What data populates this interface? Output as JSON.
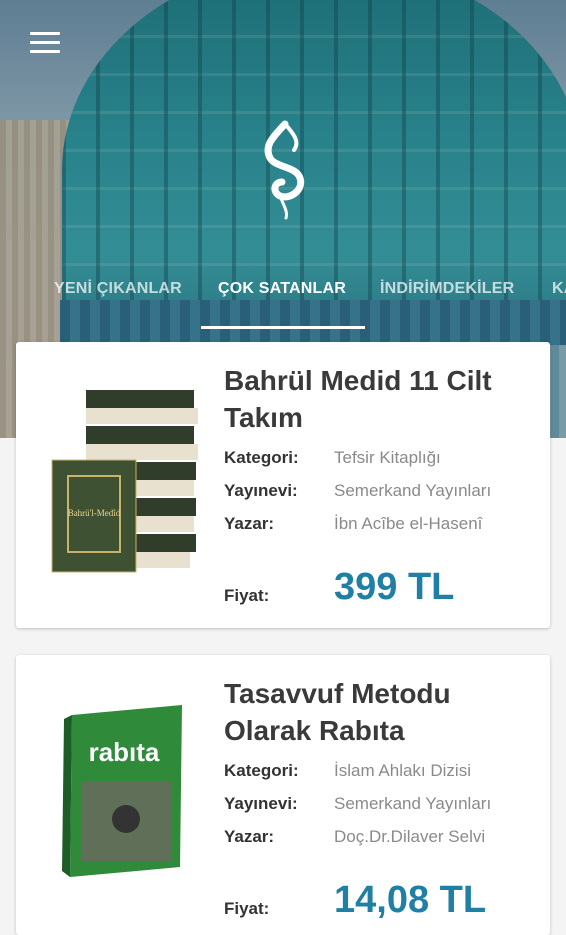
{
  "colors": {
    "accent": "#1f7fa4",
    "title": "#3a3a3a",
    "muted": "#8a8a8a"
  },
  "header": {
    "menu_icon": "hamburger-menu-icon",
    "logo_icon": "calligraphy-logo-icon"
  },
  "tabs": [
    {
      "label": "YENİ ÇIKANLAR",
      "active": false
    },
    {
      "label": "ÇOK SATANLAR",
      "active": true
    },
    {
      "label": "İNDİRİMDEKİLER",
      "active": false
    },
    {
      "label": "KA",
      "active": false
    }
  ],
  "labels": {
    "category": "Kategori:",
    "publisher": "Yayınevi:",
    "author": "Yazar:",
    "price": "Fiyat:"
  },
  "books": [
    {
      "title": "Bahrül Medid 11 Cilt Takım",
      "category": "Tefsir Kitaplığı",
      "publisher": "Semerkand Yayınları",
      "author": "İbn Acîbe el-Hasenî",
      "price": "399 TL",
      "cover_text": "Bahrü'l-Medîd"
    },
    {
      "title": "Tasavvuf Metodu Olarak Rabıta",
      "category": "İslam Ahlakı Dizisi",
      "publisher": "Semerkand Yayınları",
      "author": "Doç.Dr.Dilaver Selvi",
      "price": "14,08 TL",
      "cover_text": "rabıta"
    }
  ]
}
